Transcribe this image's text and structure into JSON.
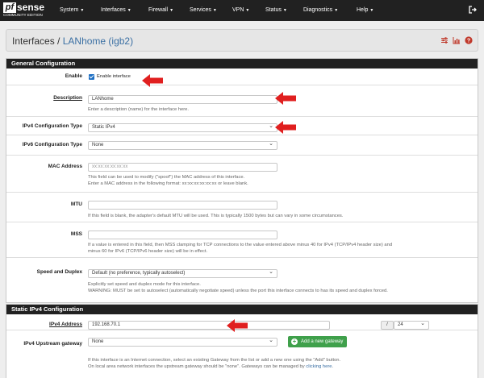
{
  "nav": {
    "logo_pf": "pf",
    "logo_sense": "sense",
    "logo_edition": "COMMUNITY EDITION",
    "items": [
      "System",
      "Interfaces",
      "Firewall",
      "Services",
      "VPN",
      "Status",
      "Diagnostics",
      "Help"
    ]
  },
  "breadcrumb": {
    "section": "Interfaces /",
    "page": "LANhome (igb2)"
  },
  "general": {
    "heading": "General Configuration",
    "enable_label": "Enable",
    "enable_text": "Enable interface",
    "description_label": "Description",
    "description_value": "LANhome",
    "description_help": "Enter a description (name) for the interface here.",
    "ipv4_label": "IPv4 Configuration Type",
    "ipv4_value": "Static IPv4",
    "ipv6_label": "IPv6 Configuration Type",
    "ipv6_value": "None",
    "mac_label": "MAC Address",
    "mac_placeholder": "xx:xx:xx:xx:xx:xx",
    "mac_help1": "This field can be used to modify (\"spoof\") the MAC address of this interface.",
    "mac_help2": "Enter a MAC address in the following format: xx:xx:xx:xx:xx:xx or leave blank.",
    "mtu_label": "MTU",
    "mtu_help": "If this field is blank, the adapter's default MTU will be used. This is typically 1500 bytes but can vary in some circumstances.",
    "mss_label": "MSS",
    "mss_help1": "If a value is entered in this field, then MSS clamping for TCP connections to the value entered above minus 40 for IPv4 (TCP/IPv4 header size) and",
    "mss_help2": "minus 60 for IPv6 (TCP/IPv6 header size) will be in effect.",
    "speed_label": "Speed and Duplex",
    "speed_value": "Default (no preference, typically autoselect)",
    "speed_help1": "Explicitly set speed and duplex mode for this interface.",
    "speed_help2": "WARNING: MUST be set to autoselect (automatically negotiate speed) unless the port this interface connects to has its speed and duplex forced."
  },
  "static": {
    "heading": "Static IPv4 Configuration",
    "addr_label": "IPv4 Address",
    "addr_value": "192.168.70.1",
    "slash": "/",
    "cidr_value": "24",
    "gw_label": "IPv4 Upstream gateway",
    "gw_value": "None",
    "add_gw_label": "Add a new gateway",
    "gw_help1": "If this interface is an Internet connection, select an existing Gateway from the list or add a new one using the \"Add\" button.",
    "gw_help2_prefix": "On local area network interfaces the upstream gateway should be \"none\". Gateways can be managed by ",
    "gw_help2_link": "clicking here",
    "gw_help2_suffix": "."
  },
  "colors": {
    "nav_bg": "#212121",
    "accent_red": "#e01f1f",
    "link": "#3a6fa3",
    "checkbox": "#1e6fc3",
    "button_green": "#3fa04b"
  }
}
